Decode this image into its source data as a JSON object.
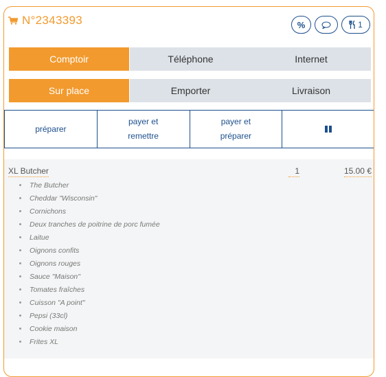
{
  "header": {
    "order_label": "N°2343393",
    "buttons": {
      "discount": "%",
      "comment_icon": "speech-bubble-icon",
      "cutlery_count": "1"
    }
  },
  "channel": {
    "options": [
      "Comptoir",
      "Téléphone",
      "Internet"
    ],
    "selected": "Comptoir"
  },
  "service": {
    "options": [
      "Sur place",
      "Emporter",
      "Livraison"
    ],
    "selected": "Sur place"
  },
  "actions": {
    "prepare": "préparer",
    "pay_and_hand_1": "payer et",
    "pay_and_hand_2": "remettre",
    "pay_and_prepare_1": "payer et",
    "pay_and_prepare_2": "préparer",
    "pause_icon": "pause-icon"
  },
  "item": {
    "name": "XL Butcher",
    "qty": "1",
    "price": "15.00 €",
    "options": [
      "The Butcher",
      "Cheddar \"Wisconsin\"",
      "Cornichons",
      "Deux tranches de poitrine de porc fumée",
      "Laitue",
      "Oignons confits",
      "Oignons rouges",
      "Sauce \"Maison\"",
      "Tomates fraîches",
      "Cuisson \"A point\"",
      "Pepsi (33cl)",
      "Cookie maison",
      "Frites XL"
    ]
  },
  "colors": {
    "accent": "#f29a2e",
    "primary": "#1c4f8c",
    "inactive": "#dde2e8"
  }
}
